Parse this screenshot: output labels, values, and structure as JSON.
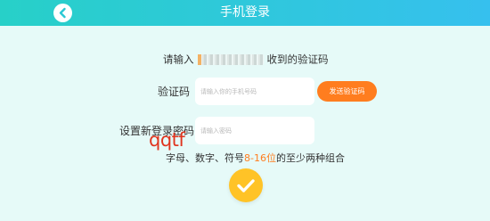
{
  "header": {
    "title": "手机登录",
    "back_icon": "chevron-left-icon"
  },
  "prompt": {
    "prefix": "请输入",
    "suffix": "收到的验证码"
  },
  "code_field": {
    "label": "验证码",
    "placeholder": "请输入你的手机号码"
  },
  "send_button": {
    "label": "发送验证码"
  },
  "password_field": {
    "label": "设置新登录密码",
    "placeholder": "请输入密码"
  },
  "overlay_text": "qqtf",
  "hint": {
    "pre": "字母、数字、符号",
    "highlight": "8-16位",
    "post": "的至少两种组合"
  },
  "confirm_button": {
    "icon": "checkmark-icon"
  },
  "colors": {
    "header_start": "#27d0c8",
    "header_end": "#36c0ee",
    "background": "#e6faf8",
    "accent_orange": "#ff7d1f",
    "confirm_yellow": "#ffc327"
  }
}
